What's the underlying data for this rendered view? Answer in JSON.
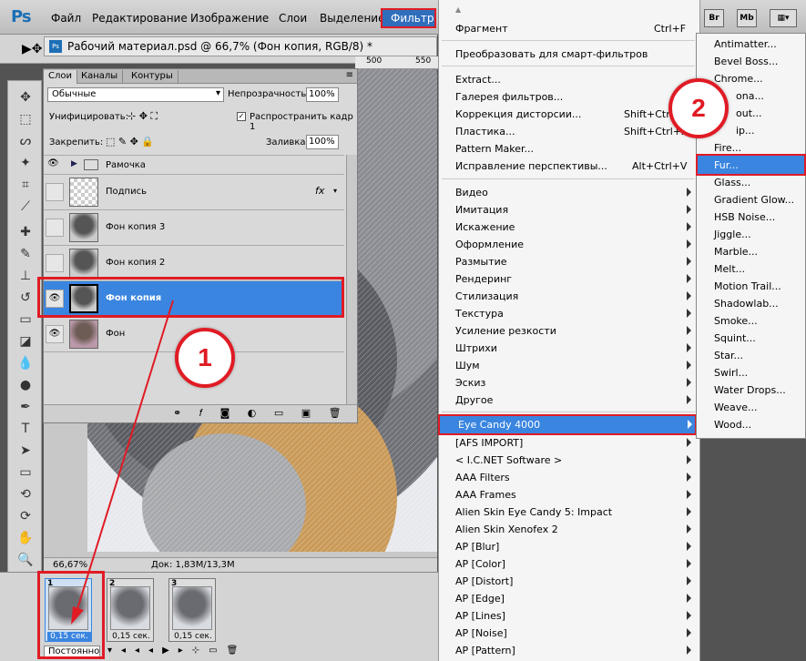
{
  "app": {
    "logo": "Ps"
  },
  "menubar": {
    "items": [
      "Файл",
      "Редактирование",
      "Изображение",
      "Слои",
      "Выделение",
      "Фильтр"
    ],
    "right_buttons": [
      "Br",
      "Mb"
    ]
  },
  "document": {
    "title": "Рабочий материал.psd @ 66,7% (Фон копия, RGB/8) *",
    "ruler_label": "500",
    "ruler_label2": "550",
    "zoom": "66,67%",
    "doc_info": "Док: 1,83M/13,3M"
  },
  "layers_panel": {
    "tabs": [
      "Слои",
      "Каналы",
      "Контуры"
    ],
    "blend_mode": "Обычные",
    "opacity_label": "Непрозрачность:",
    "opacity_value": "100%",
    "unify_label": "Унифицировать:",
    "propagate_label": "Распространить кадр 1",
    "lock_label": "Закрепить:",
    "fill_label": "Заливка:",
    "fill_value": "100%",
    "layers": [
      {
        "name": "Рамочка",
        "type": "group",
        "visible": true
      },
      {
        "name": "Подпись",
        "type": "fx",
        "visible": false
      },
      {
        "name": "Фон копия 3",
        "visible": false
      },
      {
        "name": "Фон копия 2",
        "visible": false
      },
      {
        "name": "Фон копия",
        "visible": true,
        "selected": true
      },
      {
        "name": "Фон",
        "visible": true
      }
    ]
  },
  "filter_menu": {
    "items": [
      {
        "label": "Фрагмент",
        "shortcut": "Ctrl+F"
      },
      {
        "label": "Преобразовать для смарт-фильтров"
      },
      {
        "label": "Extract..."
      },
      {
        "label": "Галерея фильтров..."
      },
      {
        "label": "Коррекция дисторсии...",
        "shortcut": "Shift+Ctrl+R"
      },
      {
        "label": "Пластика...",
        "shortcut": "Shift+Ctrl+X"
      },
      {
        "label": "Pattern Maker..."
      },
      {
        "label": "Исправление перспективы...",
        "shortcut": "Alt+Ctrl+V"
      },
      {
        "label": "Видео"
      },
      {
        "label": "Имитация"
      },
      {
        "label": "Искажение"
      },
      {
        "label": "Оформление"
      },
      {
        "label": "Размытие"
      },
      {
        "label": "Рендеринг"
      },
      {
        "label": "Стилизация"
      },
      {
        "label": "Текстура"
      },
      {
        "label": "Усиление резкости"
      },
      {
        "label": "Штрихи"
      },
      {
        "label": "Шум"
      },
      {
        "label": "Эскиз"
      },
      {
        "label": "Другое"
      },
      {
        "label": "Eye Candy 4000"
      },
      {
        "label": "[AFS IMPORT]"
      },
      {
        "label": "< I.C.NET Software >"
      },
      {
        "label": "AAA Filters"
      },
      {
        "label": "AAA Frames"
      },
      {
        "label": "Alien Skin Eye Candy 5: Impact"
      },
      {
        "label": "Alien Skin Xenofex 2"
      },
      {
        "label": "AP [Blur]"
      },
      {
        "label": "AP [Color]"
      },
      {
        "label": "AP [Distort]"
      },
      {
        "label": "AP [Edge]"
      },
      {
        "label": "AP [Lines]"
      },
      {
        "label": "AP [Noise]"
      },
      {
        "label": "AP [Pattern]"
      }
    ]
  },
  "eye_candy_submenu": {
    "items": [
      "Antimatter...",
      "Bevel Boss...",
      "Chrome...",
      "Corona...",
      "Cutout...",
      "Drip...",
      "Fire...",
      "Fur...",
      "Glass...",
      "Gradient Glow...",
      "HSB Noise...",
      "Jiggle...",
      "Marble...",
      "Melt...",
      "Motion Trail...",
      "Shadowlab...",
      "Smoke...",
      "Squint...",
      "Star...",
      "Swirl...",
      "Water Drops...",
      "Weave...",
      "Wood..."
    ],
    "visible_items": [
      "Antimatter...",
      "Bevel Boss...",
      "Chrome...",
      "ona...",
      "out...",
      "ip...",
      "Fire...",
      "Fur...",
      "Glass...",
      "Gradient Glow...",
      "HSB Noise...",
      "Jiggle...",
      "Marble...",
      "Melt...",
      "Motion Trail...",
      "Shadowlab...",
      "Smoke...",
      "Squint...",
      "Star...",
      "Swirl...",
      "Water Drops...",
      "Weave...",
      "Wood..."
    ]
  },
  "animation": {
    "frames": [
      {
        "num": "1",
        "time": "0,15 сек."
      },
      {
        "num": "2",
        "time": "0,15 сек."
      },
      {
        "num": "3",
        "time": "0,15 сек."
      }
    ],
    "loop": "Постоянно"
  },
  "annotations": {
    "badge1": "1",
    "badge2": "2"
  },
  "colors": {
    "accent_red": "#e01b24",
    "highlight_blue": "#3a85e0",
    "menu_bg": "#f5f5f5"
  }
}
